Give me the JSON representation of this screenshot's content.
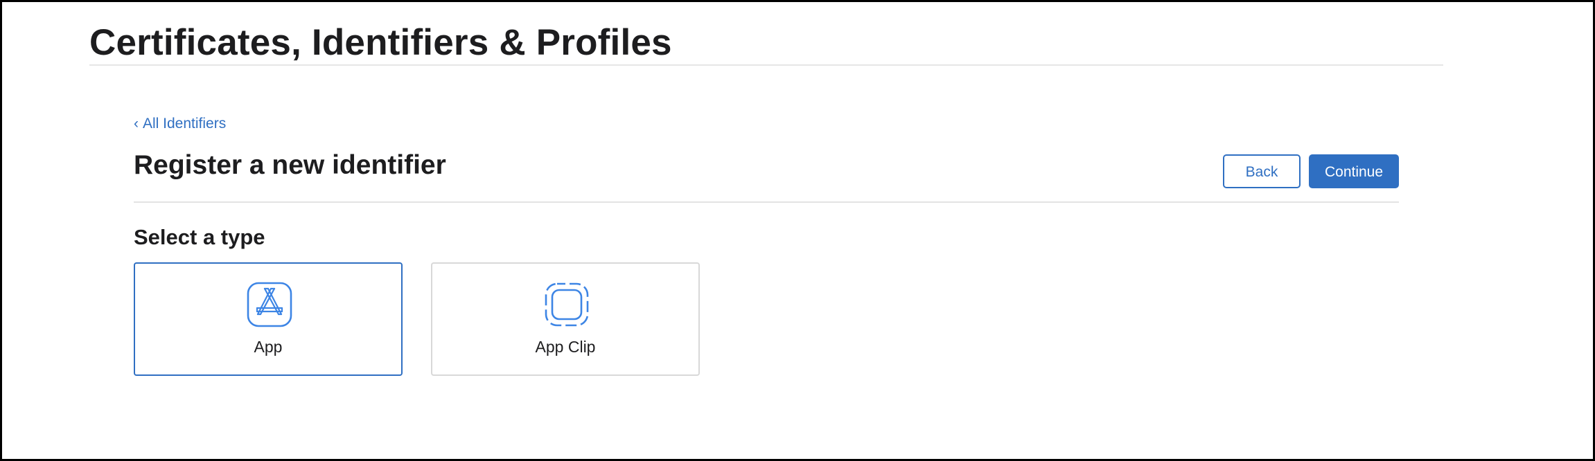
{
  "header": {
    "title": "Certificates, Identifiers & Profiles"
  },
  "breadcrumb": {
    "chevron": "‹",
    "label": "All Identifiers"
  },
  "page": {
    "title": "Register a new identifier"
  },
  "actions": {
    "back_label": "Back",
    "continue_label": "Continue"
  },
  "type_section": {
    "heading": "Select a type",
    "selected": "App",
    "options": [
      {
        "label": "App",
        "icon": "app-store-icon"
      },
      {
        "label": "App Clip",
        "icon": "app-clip-icon"
      }
    ]
  },
  "colors": {
    "accent": "#2f6fc2",
    "icon_blue": "#3d85e5",
    "text": "#1d1d1f",
    "divider": "#e3e3e3"
  }
}
